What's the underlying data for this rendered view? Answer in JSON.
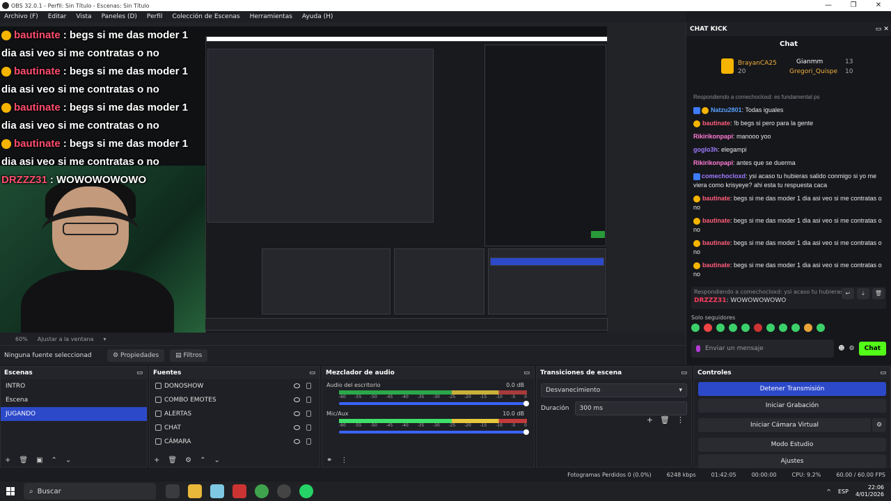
{
  "window": {
    "title": "OBS 32.0.1 - Perfil: Sin Título - Escenas: Sin Título"
  },
  "menu": [
    "Archivo (F)",
    "Editar",
    "Vista",
    "Paneles (D)",
    "Perfil",
    "Colección de Escenas",
    "Herramientas",
    "Ayuda (H)"
  ],
  "overlay_chat": [
    {
      "user": "bautinate",
      "text": ": begs si me das moder 1"
    },
    {
      "user": "",
      "text": "dia asi veo si me contratas o no"
    },
    {
      "user": "bautinate",
      "text": ": begs si me das moder 1"
    },
    {
      "user": "",
      "text": "dia asi veo si me contratas o no"
    },
    {
      "user": "bautinate",
      "text": ": begs si me das moder 1"
    },
    {
      "user": "",
      "text": "dia asi veo si me contratas o no"
    },
    {
      "user": "bautinate",
      "text": ": begs si me das moder 1"
    },
    {
      "user": "",
      "text": "dia asi veo si me contratas o no"
    },
    {
      "user": "DRZZZ31",
      "text": ": WOWOWOWOWO"
    }
  ],
  "preview": {
    "zoom": "60%",
    "fit_label": "Ajustar a la ventana"
  },
  "source_bar": {
    "no_selection": "Ninguna fuente seleccionad",
    "properties": "Propiedades",
    "filters": "Filtros"
  },
  "chat_dock": {
    "title": "CHAT KICK",
    "header": "Chat",
    "leaderboard": [
      {
        "name": "BrayanCA25",
        "count": "20"
      },
      {
        "name": "Gianmm",
        "count": "13"
      },
      {
        "name": "Gregori_Quispe",
        "count": "10"
      }
    ],
    "messages": [
      {
        "reply": "Respondiendo a comechocloxd: es fundamental ps",
        "user": "",
        "text": ""
      },
      {
        "reply": "",
        "user": "Natzu2801",
        "text": ": Todas iguales"
      },
      {
        "reply": "",
        "user": "bautinate",
        "text": ": !b begs si pero para la gente"
      },
      {
        "reply": "",
        "user": "Rikirikonpapi",
        "text": ": manooo yoo"
      },
      {
        "reply": "",
        "user": "goglo3h",
        "text": ": elegampi"
      },
      {
        "reply": "",
        "user": "Rikirikonpapi",
        "text": ": antes que se duerma"
      },
      {
        "reply": "",
        "user": "comechocloxd",
        "text": ": ysi acaso tu hubieras salido conmigo si yo me viera como krisyeye? ahi esta tu respuesta caca"
      },
      {
        "reply": "",
        "user": "bautinate",
        "text": ": begs si me das moder 1 dia asi veo si me contratas o no"
      },
      {
        "reply": "",
        "user": "bautinate",
        "text": ": begs si me das moder 1 dia asi veo si me contratas o no"
      },
      {
        "reply": "",
        "user": "bautinate",
        "text": ": begs si me das moder 1 dia asi veo si me contratas o no"
      },
      {
        "reply": "",
        "user": "bautinate",
        "text": ": begs si me das moder 1 dia asi veo si me contratas o no"
      }
    ],
    "reply_card": {
      "reply": "Respondiendo a comechocloxd: ysi acaso tu hubieras s",
      "user": "DRZZZ31",
      "text": ": WOWOWOWOWO"
    },
    "followers_only": "Solo seguidores",
    "input_placeholder": "Enviar un mensaje",
    "chat_button": "Chat"
  },
  "scenes": {
    "title": "Escenas",
    "items": [
      "INTRO",
      "Escena",
      "JUGANDO"
    ],
    "selected": "JUGANDO"
  },
  "sources": {
    "title": "Fuentes",
    "items": [
      "DONOSHOW",
      "COMBO EMOTES",
      "ALERTAS",
      "CHAT",
      "CÁMARA"
    ]
  },
  "mixer": {
    "title": "Mezclador de audio",
    "channels": [
      {
        "name": "Audio del escritorio",
        "db": "0.0 dB"
      },
      {
        "name": "Mic/Aux",
        "db": "10.0 dB"
      }
    ],
    "ticks": [
      "-60",
      "-55",
      "-50",
      "-45",
      "-40",
      "-35",
      "-30",
      "-25",
      "-20",
      "-15",
      "-10",
      "-5",
      "0"
    ]
  },
  "transitions": {
    "title": "Transiciones de escena",
    "selected": "Desvanecimiento",
    "duration_label": "Duración",
    "duration": "300 ms"
  },
  "controls": {
    "title": "Controles",
    "buttons": [
      "Detener Transmisión",
      "Iniciar Grabación",
      "Iniciar Cámara Virtual",
      "Modo Estudio",
      "Ajustes"
    ]
  },
  "status": {
    "dropped": "Fotogramas Perdidos 0 (0.0%)",
    "bitrate": "6248 kbps",
    "stream_time": "01:42:05",
    "rec_time": "00:00:00",
    "cpu": "CPU: 9.2%",
    "fps": "60.00 / 60.00 FPS"
  },
  "taskbar": {
    "search": "Buscar",
    "lang": "ESP",
    "time": "22:06",
    "date": "4/01/2026"
  }
}
